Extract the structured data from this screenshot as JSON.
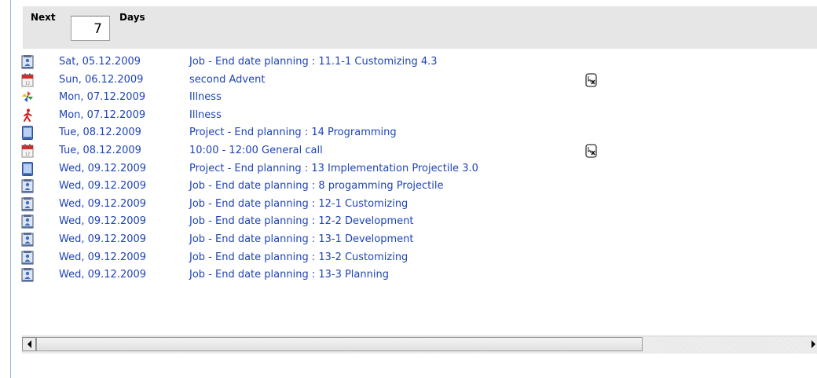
{
  "header": {
    "next_label": "Next",
    "days_value": "7",
    "days_label": "Days"
  },
  "colors": {
    "link_text": "#1f44b8",
    "header_bg": "#e6e6e6"
  },
  "rows": [
    {
      "icon": "person-icon",
      "date": "Sat, 05.12.2009",
      "desc": "Job - End date planning : 11.1-1 Customizing 4.3",
      "action": false
    },
    {
      "icon": "calendar-icon",
      "date": "Sun, 06.12.2009",
      "desc": "second Advent",
      "action": true
    },
    {
      "icon": "pinwheel-icon",
      "date": "Mon, 07.12.2009",
      "desc": "Illness",
      "action": false
    },
    {
      "icon": "walking-person-icon",
      "date": "Mon, 07.12.2009",
      "desc": "Illness",
      "action": false
    },
    {
      "icon": "project-icon",
      "date": "Tue, 08.12.2009",
      "desc": "Project - End planning : 14 Programming",
      "action": false
    },
    {
      "icon": "calendar-icon",
      "date": "Tue, 08.12.2009",
      "desc": "10:00 - 12:00 General call",
      "action": true
    },
    {
      "icon": "project-icon",
      "date": "Wed, 09.12.2009",
      "desc": "Project - End planning : 13 Implementation Projectile 3.0",
      "action": false
    },
    {
      "icon": "person-icon",
      "date": "Wed, 09.12.2009",
      "desc": "Job - End date planning : 8 progamming Projectile",
      "action": false
    },
    {
      "icon": "person-icon",
      "date": "Wed, 09.12.2009",
      "desc": "Job - End date planning : 12-1 Customizing",
      "action": false
    },
    {
      "icon": "person-icon",
      "date": "Wed, 09.12.2009",
      "desc": "Job - End date planning : 12-2 Development",
      "action": false
    },
    {
      "icon": "person-icon",
      "date": "Wed, 09.12.2009",
      "desc": "Job - End date planning : 13-1 Development",
      "action": false
    },
    {
      "icon": "person-icon",
      "date": "Wed, 09.12.2009",
      "desc": "Job - End date planning : 13-2 Customizing",
      "action": false
    },
    {
      "icon": "person-icon",
      "date": "Wed, 09.12.2009",
      "desc": "Job - End date planning : 13-3 Planning",
      "action": false
    }
  ]
}
